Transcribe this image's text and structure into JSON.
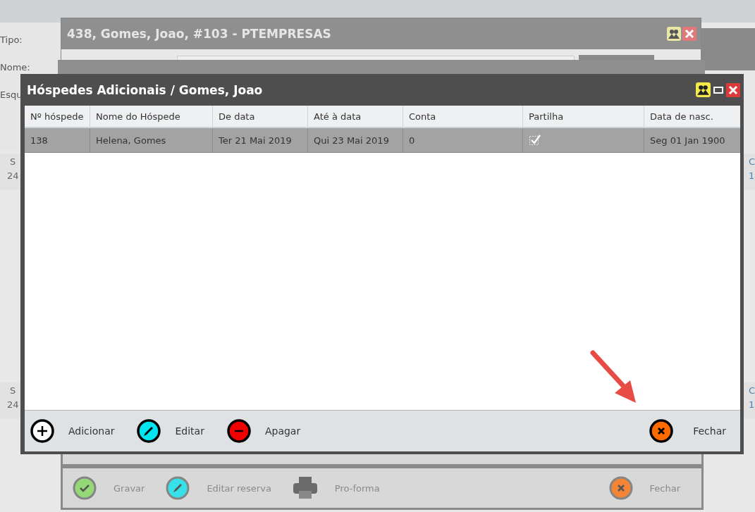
{
  "background_form": {
    "labels": [
      "Tipo:",
      "Nome:",
      "Esqu"
    ]
  },
  "background_rows": [
    {
      "column_1": "S",
      "column_2": "24",
      "column_3": "C",
      "column_4": "1"
    },
    {
      "column_1": "S",
      "column_2": "24",
      "column_3": "C",
      "column_4": "1"
    }
  ],
  "back_window": {
    "title": "438, Gomes, Joao, #103 - PTEMPRESAS",
    "toolbar": [
      {
        "kind": "save",
        "label": "Gravar"
      },
      {
        "kind": "edit",
        "label": "Editar reserva"
      },
      {
        "kind": "print",
        "label": "Pro-forma"
      },
      {
        "kind": "close",
        "label": "Fechar"
      }
    ]
  },
  "dialog": {
    "title": "Hóspedes Adicionais / Gomes, Joao",
    "table": {
      "columns": [
        "Nº hóspede",
        "Nome do Hóspede",
        "De data",
        "Até à data",
        "Conta",
        "Partilha",
        "Data de nasc."
      ],
      "rows": [
        {
          "selected": true,
          "guest_no": "138",
          "name": "Helena, Gomes",
          "from": "Ter 21 Mai 2019",
          "to": "Qui 23 Mai 2019",
          "account": "0",
          "shared": true,
          "birth": "Seg 01 Jan 1900"
        }
      ]
    },
    "toolbar": [
      {
        "kind": "add",
        "label": "Adicionar"
      },
      {
        "kind": "edit",
        "label": "Editar"
      },
      {
        "kind": "delete",
        "label": "Apagar"
      },
      {
        "kind": "close",
        "label": "Fechar"
      }
    ]
  }
}
